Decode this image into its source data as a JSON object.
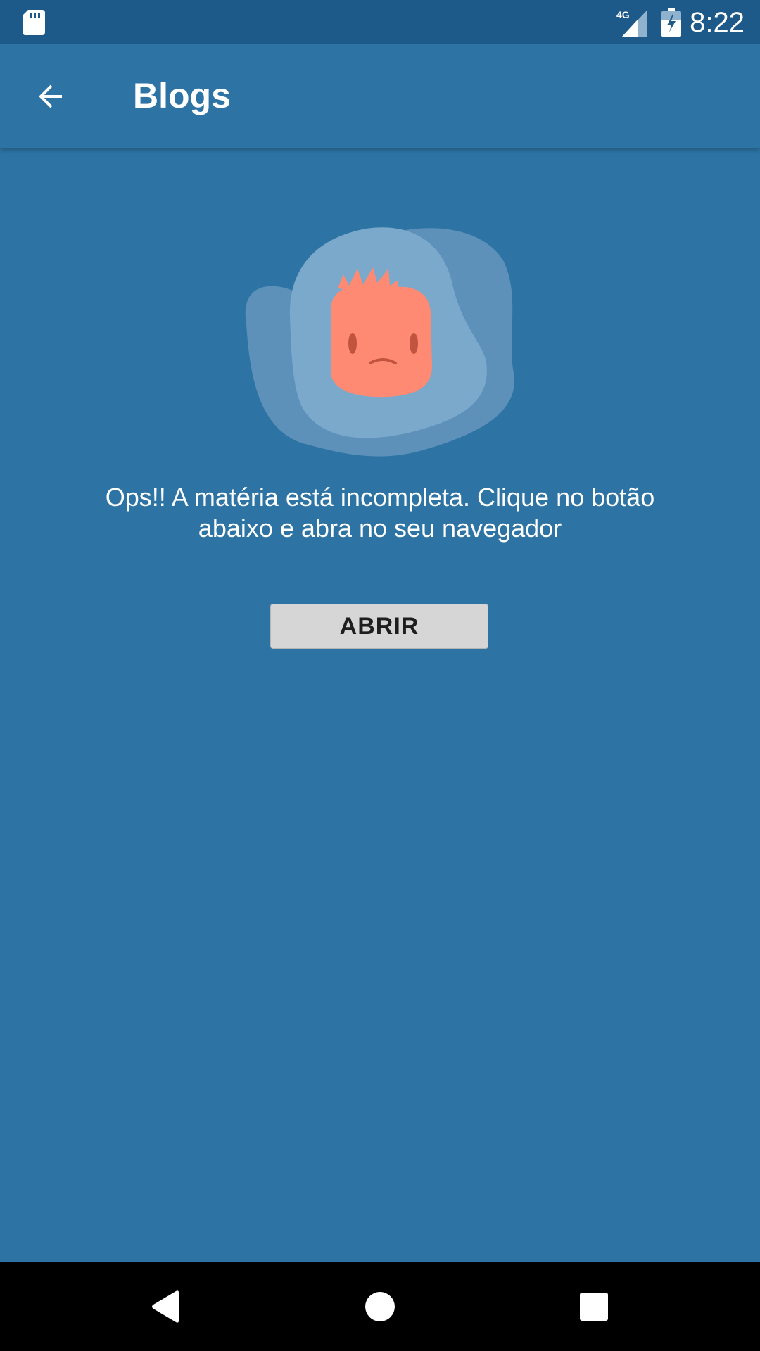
{
  "status_bar": {
    "network_label": "4G",
    "time": "8:22"
  },
  "app_bar": {
    "title": "Blogs",
    "back_icon": "arrow-back-icon"
  },
  "content": {
    "illustration": "sad-face-icon",
    "message": "Ops!! A matéria está incompleta. Clique no botão abaixo e abra no seu navegador",
    "open_button_label": "ABRIR"
  },
  "nav_bar": {
    "back_icon": "nav-back-icon",
    "home_icon": "nav-home-icon",
    "recents_icon": "nav-recents-icon"
  },
  "colors": {
    "status_bar": "#1e5a89",
    "primary": "#2d74a5",
    "button": "#d6d6d6",
    "face": "#ff8a73"
  }
}
